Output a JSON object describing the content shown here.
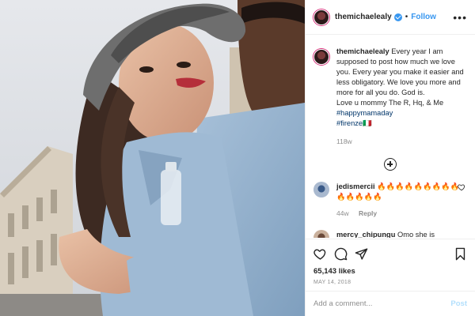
{
  "post": {
    "username": "themichaelealy",
    "follow_label": "Follow",
    "more_glyph": "•••",
    "dot": "•",
    "caption": {
      "username": "themichaelealy",
      "text": "Every year I am supposed to post how much we love you. Every year you make it easier and less obligatory. We love you more and more for all you do. God is.",
      "signoff": "Love u mommy The R, Hq, & Me",
      "hashtags": [
        "#happymamaday",
        "#firenze🇮🇹"
      ],
      "time": "118w"
    },
    "comments": [
      {
        "username": "jedismercii",
        "text": "🔥🔥🔥🔥🔥🔥🔥🔥🔥🔥🔥🔥🔥🔥",
        "time": "44w",
        "reply_label": "Reply",
        "avatar_icon": "user-avatar"
      },
      {
        "username": "mercy_chipungu",
        "text": "Omo she is",
        "time": "",
        "reply_label": "",
        "avatar_icon": "user-avatar"
      }
    ],
    "likes": "65,143 likes",
    "date": "MAY 14, 2018",
    "add_comment_placeholder": "Add a comment...",
    "post_label": "Post"
  },
  "icons": {
    "header_avatar": "profile-avatar",
    "verified": "verified-badge-icon",
    "like": "heart-icon",
    "comment": "comment-bubble-icon",
    "share": "paper-plane-icon",
    "save": "bookmark-icon",
    "load_more": "plus-circle-icon"
  },
  "colors": {
    "accent_blue": "#3897f0",
    "hashtag": "#003569",
    "muted": "#8e8e8e",
    "border": "#efefef",
    "post_disabled": "#b2dffc"
  }
}
